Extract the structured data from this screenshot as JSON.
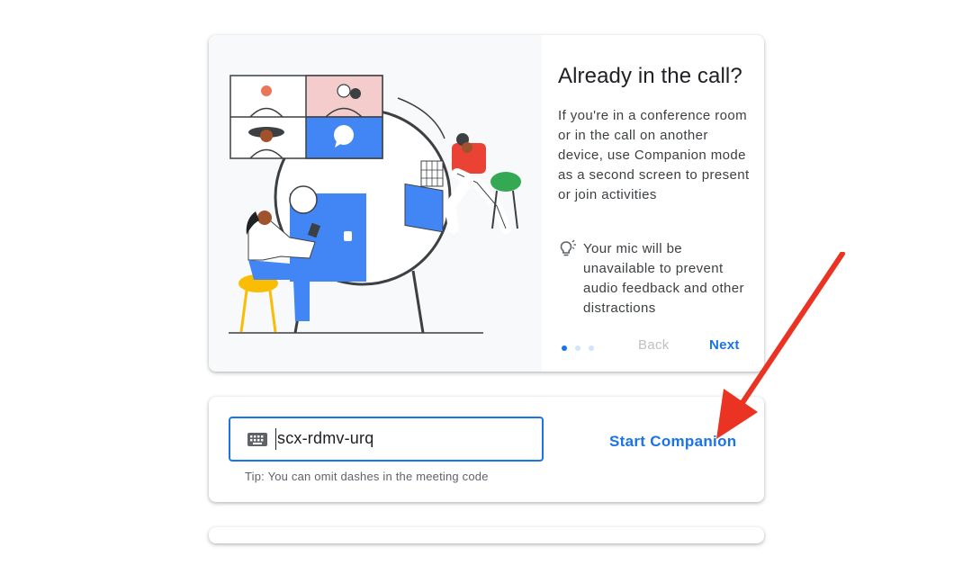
{
  "intro": {
    "title": "Already in the call?",
    "body": "If you're in a conference room or in the call on another device, use Companion mode as a second screen to present or join activities",
    "tip": "Your mic will be unavailable to prevent audio feedback and other distractions",
    "tip_icon": "lightbulb-icon",
    "illustration": "video-call-illustration",
    "pager": {
      "count": 3,
      "active_index": 0
    },
    "back_label": "Back",
    "next_label": "Next"
  },
  "join": {
    "input_icon": "keyboard-icon",
    "code_value": "scx-rdmv-urq",
    "tip": "Tip: You can omit dashes in the meeting code",
    "start_label": "Start Companion"
  },
  "annotation": {
    "type": "red-arrow-pointing-to-start-companion"
  },
  "colors": {
    "accent": "#1a73e8",
    "disabled": "#bdc1c6",
    "title_text": "#202124",
    "body_text": "#3c4043",
    "annotation_arrow": "#ea3323"
  }
}
